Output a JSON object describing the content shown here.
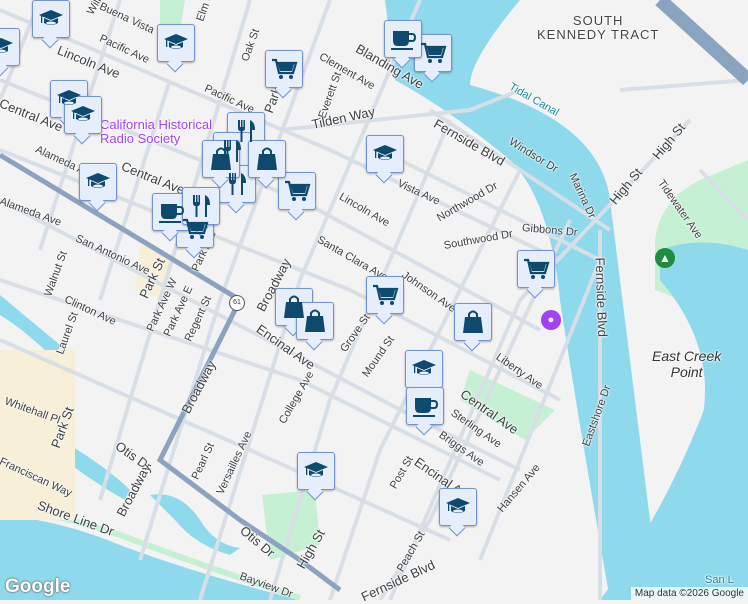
{
  "map": {
    "areas": {
      "south_kennedy_tract": "SOUTH\nKENNEDY TRACT",
      "east_creek_point": "East Creek\nPoint"
    },
    "poi": {
      "radio_society": "California Historical\nRadio Society"
    },
    "water": {
      "tidal_canal": "Tidal Canal",
      "san_le": "San L"
    },
    "highway_shield": "61",
    "streets": [
      "Buena Vista",
      "Elm St",
      "Pacific Ave",
      "Pacific Ave",
      "Lincoln Ave",
      "Central Ave",
      "Oak St",
      "Blanding Ave",
      "Clement Ave",
      "Everett St",
      "Tilden Way",
      "Park St",
      "Alameda Ave",
      "Central Ave",
      "Walnut St",
      "San Antonio Ave",
      "Park Ave",
      "Park St",
      "Broadway",
      "Lincoln Ave",
      "Santa Clara Ave",
      "Fernside Blvd",
      "Windsor Dr",
      "Vista Ave",
      "Northwood Dr",
      "Marina Dr",
      "High St",
      "High St",
      "Tidewater Ave",
      "Gibbons Dr",
      "Southwood Dr",
      "Fernside Blvd",
      "Johnson Ave",
      "Alameda Ave",
      "Clinton Ave",
      "Laurel St",
      "Park Ave W",
      "Park Ave E",
      "Regent St",
      "Encinal Ave",
      "Grove St",
      "Mound St",
      "Liberty Ave",
      "Central Ave",
      "Sterling Ave",
      "Briggs Ave",
      "Eastshore Dr",
      "Whitehall Pl",
      "Park St",
      "Otis Dr",
      "Broadway",
      "Broadway",
      "College Ave",
      "Pearl St",
      "Versailles Ave",
      "Encinal Ave",
      "Post St",
      "Hansen Ave",
      "Shore Line Dr",
      "Otis Dr",
      "High St",
      "Peach St",
      "Bayview Dr",
      "Fernside Blvd",
      "Willow St",
      "Franciscan Way"
    ],
    "markers": [
      {
        "type": "school"
      },
      {
        "type": "school"
      },
      {
        "type": "school"
      },
      {
        "type": "school"
      },
      {
        "type": "school"
      },
      {
        "type": "school"
      },
      {
        "type": "school"
      },
      {
        "type": "school"
      },
      {
        "type": "school"
      },
      {
        "type": "school"
      },
      {
        "type": "cart"
      },
      {
        "type": "cart"
      },
      {
        "type": "cart"
      },
      {
        "type": "cart"
      },
      {
        "type": "cart"
      },
      {
        "type": "cart"
      },
      {
        "type": "coffee"
      },
      {
        "type": "coffee"
      },
      {
        "type": "coffee"
      },
      {
        "type": "restaurant"
      },
      {
        "type": "restaurant"
      },
      {
        "type": "restaurant"
      },
      {
        "type": "restaurant"
      },
      {
        "type": "shopping"
      },
      {
        "type": "shopping"
      },
      {
        "type": "shopping"
      },
      {
        "type": "shopping"
      },
      {
        "type": "shopping"
      }
    ],
    "colors": {
      "water": "#8fd9ec",
      "park": "#c5f0d3",
      "road": "#d3dbe3",
      "highway": "#8ca3bf",
      "marker_icon": "#0d4a6e",
      "marker_bg": "#e6eefc",
      "poi": "#a142f4"
    },
    "google_logo": "Google",
    "attribution": "Map data ©2026 Google"
  }
}
